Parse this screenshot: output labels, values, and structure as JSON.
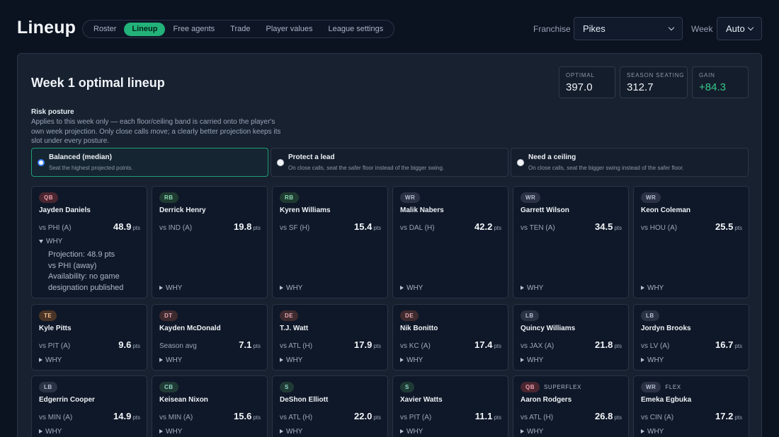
{
  "app": {
    "title": "Lineup"
  },
  "nav": {
    "tabs": [
      "Roster",
      "Lineup",
      "Free agents",
      "Trade",
      "Player values",
      "League settings"
    ],
    "active": 1
  },
  "controls": {
    "franchise_label": "Franchise",
    "franchise_value": "Pikes",
    "week_label": "Week",
    "week_value": "Auto"
  },
  "panel": {
    "title": "Week 1 optimal lineup"
  },
  "stats": [
    {
      "label": "OPTIMAL",
      "value": "397.0"
    },
    {
      "label": "SEASON SEATING",
      "value": "312.7"
    },
    {
      "label": "GAIN",
      "value": "+84.3"
    }
  ],
  "risk": {
    "heading": "Risk posture",
    "description": "Applies to this week only — each floor/ceiling band is carried onto the player's own week projection. Only close calls move; a clearly better projection keeps its slot under every posture.",
    "options": [
      {
        "title": "Balanced (median)",
        "subtitle": "Seat the highest projected points.",
        "selected": true
      },
      {
        "title": "Protect a lead",
        "subtitle": "On close calls, seat the safer floor instead of the bigger swing.",
        "selected": false
      },
      {
        "title": "Need a ceiling",
        "subtitle": "On close calls, seat the bigger swing instead of the safer floor.",
        "selected": false
      }
    ]
  },
  "units": {
    "pts": "pts"
  },
  "why_label": "WHY",
  "players": [
    {
      "pos": "QB",
      "slot": "",
      "name": "Jayden Daniels",
      "opp": "vs PHI (A)",
      "pts": "48.9",
      "expanded": true,
      "details": [
        "Projection: 48.9 pts",
        "vs PHI (away)",
        "Availability: no game designation published"
      ]
    },
    {
      "pos": "RB",
      "slot": "",
      "name": "Derrick Henry",
      "opp": "vs IND (A)",
      "pts": "19.8"
    },
    {
      "pos": "RB",
      "slot": "",
      "name": "Kyren Williams",
      "opp": "vs SF (H)",
      "pts": "15.4"
    },
    {
      "pos": "WR",
      "slot": "",
      "name": "Malik Nabers",
      "opp": "vs DAL (H)",
      "pts": "42.2"
    },
    {
      "pos": "WR",
      "slot": "",
      "name": "Garrett Wilson",
      "opp": "vs TEN (A)",
      "pts": "34.5"
    },
    {
      "pos": "WR",
      "slot": "",
      "name": "Keon Coleman",
      "opp": "vs HOU (A)",
      "pts": "25.5"
    },
    {
      "pos": "TE",
      "slot": "",
      "name": "Kyle Pitts",
      "opp": "vs PIT (A)",
      "pts": "9.6"
    },
    {
      "pos": "DT",
      "slot": "",
      "name": "Kayden McDonald",
      "opp": "Season avg",
      "pts": "7.1"
    },
    {
      "pos": "DE",
      "slot": "",
      "name": "T.J. Watt",
      "opp": "vs ATL (H)",
      "pts": "17.9"
    },
    {
      "pos": "DE",
      "slot": "",
      "name": "Nik Bonitto",
      "opp": "vs KC (A)",
      "pts": "17.4"
    },
    {
      "pos": "LB",
      "slot": "",
      "name": "Quincy Williams",
      "opp": "vs JAX (A)",
      "pts": "21.8"
    },
    {
      "pos": "LB",
      "slot": "",
      "name": "Jordyn Brooks",
      "opp": "vs LV (A)",
      "pts": "16.7"
    },
    {
      "pos": "LB",
      "slot": "",
      "name": "Edgerrin Cooper",
      "opp": "vs MIN (A)",
      "pts": "14.9"
    },
    {
      "pos": "CB",
      "slot": "",
      "name": "Keisean Nixon",
      "opp": "vs MIN (A)",
      "pts": "15.6"
    },
    {
      "pos": "S",
      "slot": "",
      "name": "DeShon Elliott",
      "opp": "vs ATL (H)",
      "pts": "22.0"
    },
    {
      "pos": "S",
      "slot": "",
      "name": "Xavier Watts",
      "opp": "vs PIT (A)",
      "pts": "11.1"
    },
    {
      "pos": "QB",
      "slot": "SUPERFLEX",
      "name": "Aaron Rodgers",
      "opp": "vs ATL (H)",
      "pts": "26.8"
    },
    {
      "pos": "WR",
      "slot": "FLEX",
      "name": "Emeka Egbuka",
      "opp": "vs CIN (A)",
      "pts": "17.2"
    }
  ]
}
